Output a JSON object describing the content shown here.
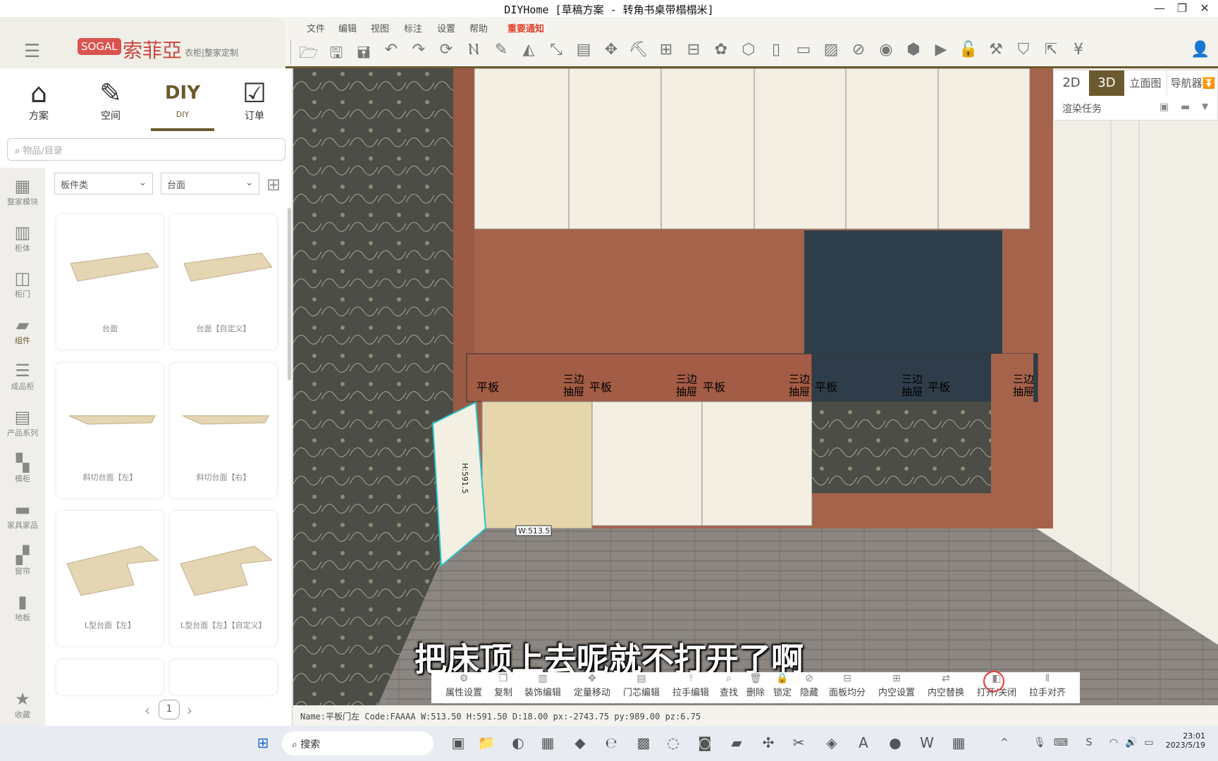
{
  "window": {
    "title": "DIYHome [草稿方案 - 转角书桌带榻榻米]",
    "minimize": "—",
    "restore": "❐",
    "close": "✕"
  },
  "brand": {
    "logo_box": "SOGAL",
    "logo_cn": "索菲亞",
    "tagline": "衣柜|整家定制",
    "color": "#d9534f"
  },
  "menu": [
    "文件",
    "编辑",
    "视图",
    "标注",
    "设置",
    "帮助"
  ],
  "notice": "重要通知",
  "toolbar_icons": [
    "folder-open",
    "save",
    "save-as",
    "undo",
    "redo",
    "refresh",
    "dimension",
    "pencil",
    "mirror",
    "resize",
    "document",
    "move",
    "paint",
    "grid",
    "align",
    "gear-flower",
    "cube-shape",
    "phone",
    "window",
    "image",
    "eye-off",
    "eye",
    "box",
    "camera",
    "unlock",
    "wrench",
    "shield",
    "export",
    "price",
    "user"
  ],
  "toptabs": [
    {
      "label": "方案",
      "icon": "house"
    },
    {
      "label": "空间",
      "icon": "edit"
    },
    {
      "label": "DIY",
      "icon": "diy"
    },
    {
      "label": "订单",
      "icon": "checklist"
    }
  ],
  "active_tab": "DIY",
  "search": {
    "placeholder": "物品/目录"
  },
  "filters": {
    "category": "板件类",
    "sub": "台面"
  },
  "strip": [
    {
      "label": "整家模块",
      "icon": "module"
    },
    {
      "label": "柜体",
      "icon": "cabinet"
    },
    {
      "label": "柜门",
      "icon": "door"
    },
    {
      "label": "组件",
      "icon": "component"
    },
    {
      "label": "成品柜",
      "icon": "finished"
    },
    {
      "label": "产品系列",
      "icon": "series"
    },
    {
      "label": "模柜",
      "icon": "mold"
    },
    {
      "label": "家具家品",
      "icon": "furniture"
    },
    {
      "label": "窗帘",
      "icon": "curtain"
    },
    {
      "label": "地板",
      "icon": "floor"
    },
    {
      "label": "收藏",
      "icon": "star"
    }
  ],
  "items": [
    "台面",
    "台面【自定义】",
    "斜切台面【左】",
    "斜切台面【右】",
    "L型台面【左】",
    "L型台面【左】【自定义】"
  ],
  "pagination": {
    "page": "1",
    "prev": "‹",
    "next": "›"
  },
  "view": {
    "b2d": "2D",
    "b3d": "3D",
    "elev": "立面图",
    "nav": "导航器",
    "render": "渲染任务",
    "active": "3D",
    "accent": "#6b5a2e"
  },
  "scene": {
    "labels_flat": [
      "平板",
      "平板",
      "平板",
      "平板",
      "平板"
    ],
    "labels_drawer": [
      "三边\n抽屉",
      "三边\n抽屉",
      "三边\n抽屉",
      "三边\n抽屉",
      "三边\n抽屉"
    ],
    "dim_h": "H:591.5",
    "dim_w": "W:513.5"
  },
  "bottombar": [
    {
      "label": "属性设置",
      "icon": "gear"
    },
    {
      "label": "复制",
      "icon": "copy"
    },
    {
      "label": "装饰编辑",
      "icon": "decor"
    },
    {
      "label": "定量移动",
      "icon": "move"
    },
    {
      "label": "门芯编辑",
      "icon": "door-core"
    },
    {
      "label": "拉手编辑",
      "icon": "handle"
    },
    {
      "label": "查找",
      "icon": "search"
    },
    {
      "label": "删除",
      "icon": "trash"
    },
    {
      "label": "锁定",
      "icon": "lock"
    },
    {
      "label": "隐藏",
      "icon": "eye-off"
    },
    {
      "label": "面板均分",
      "icon": "split"
    },
    {
      "label": "内空设置",
      "icon": "inner"
    },
    {
      "label": "内空替换",
      "icon": "swap"
    },
    {
      "label": "打开/关闭",
      "icon": "door-open"
    },
    {
      "label": "拉手对齐",
      "icon": "align"
    }
  ],
  "subtitle": "把床顶上去呢就不打开了啊",
  "status": "Name:平板门左 Code:FAAAA W:513.50 H:591.50 D:18.00 px:-2743.75 py:989.00 pz:6.75",
  "taskbar": {
    "search": "搜索",
    "time": "23:01",
    "date": "2023/5/19"
  }
}
